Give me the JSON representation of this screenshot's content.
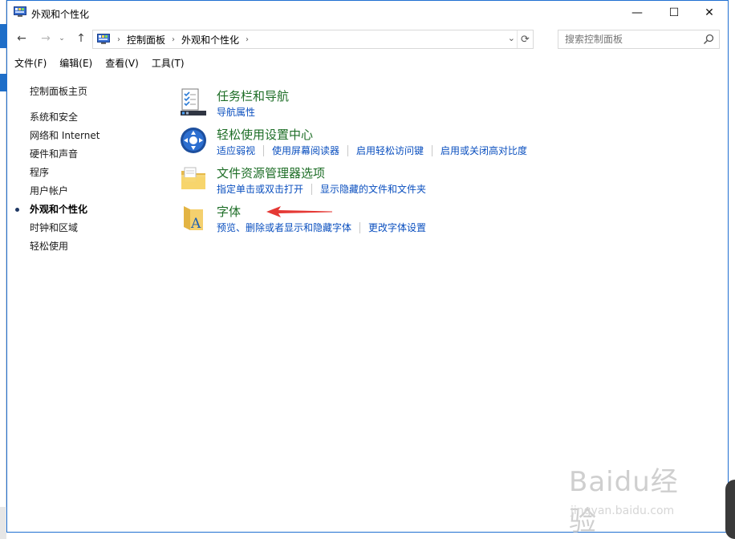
{
  "window": {
    "title": "外观和个性化",
    "minimize_label": "—",
    "maximize_label": "☐",
    "close_label": "✕"
  },
  "nav": {
    "back": "←",
    "forward": "→",
    "recent": "⌄",
    "up": "↑"
  },
  "address": {
    "crumbs": [
      "控制面板",
      "外观和个性化"
    ],
    "separator": "›",
    "dropdown": "⌄",
    "refresh": "⟳"
  },
  "search": {
    "placeholder": "搜索控制面板"
  },
  "menu": [
    "文件(F)",
    "编辑(E)",
    "查看(V)",
    "工具(T)"
  ],
  "sidebar": {
    "home": "控制面板主页",
    "categories": [
      {
        "label": "系统和安全",
        "active": false
      },
      {
        "label": "网络和 Internet",
        "active": false
      },
      {
        "label": "硬件和声音",
        "active": false
      },
      {
        "label": "程序",
        "active": false
      },
      {
        "label": "用户帐户",
        "active": false
      },
      {
        "label": "外观和个性化",
        "active": true
      },
      {
        "label": "时钟和区域",
        "active": false
      },
      {
        "label": "轻松使用",
        "active": false
      }
    ]
  },
  "sections": [
    {
      "title": "任务栏和导航",
      "icon": "taskbar-checklist-icon",
      "links": [
        "导航属性"
      ]
    },
    {
      "title": "轻松使用设置中心",
      "icon": "ease-of-access-icon",
      "links": [
        "适应弱视",
        "使用屏幕阅读器",
        "启用轻松访问键",
        "启用或关闭高对比度"
      ]
    },
    {
      "title": "文件资源管理器选项",
      "icon": "folder-options-icon",
      "links": [
        "指定单击或双击打开",
        "显示隐藏的文件和文件夹"
      ]
    },
    {
      "title": "字体",
      "icon": "fonts-folder-icon",
      "links": [
        "预览、删除或者显示和隐藏字体",
        "更改字体设置"
      ]
    }
  ],
  "watermark": {
    "logo": "Baidu经验",
    "url": "jingyan.baidu.com"
  },
  "colors": {
    "title_green": "#1e6e27",
    "link_blue": "#0a4fbf",
    "window_border": "#1f6fd1",
    "annotation_arrow": "#e53935"
  }
}
